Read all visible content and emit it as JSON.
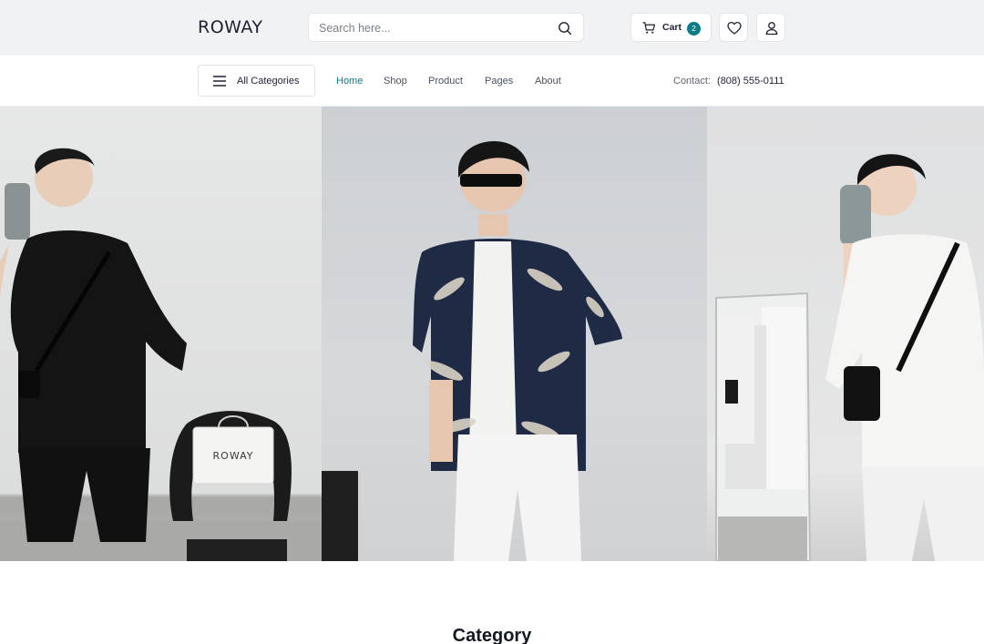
{
  "brand": {
    "logo": "ROWAY"
  },
  "search": {
    "placeholder": "Search here..."
  },
  "header": {
    "cart_label": "Cart",
    "cart_count": "2"
  },
  "nav": {
    "categories_label": "All Categories",
    "links": [
      {
        "label": "Home",
        "active": true
      },
      {
        "label": "Shop",
        "active": false
      },
      {
        "label": "Product",
        "active": false
      },
      {
        "label": "Pages",
        "active": false
      },
      {
        "label": "About",
        "active": false
      }
    ],
    "contact_label": "Contact:",
    "contact_phone": "(808) 555-0111"
  },
  "hero": {
    "bag_brand": "ROWAY"
  },
  "sections": {
    "category_title": "Category"
  },
  "colors": {
    "accent": "#0b7b86",
    "topbar_bg": "#f1f2f4",
    "text_dark": "#1c2133"
  },
  "icons": [
    "search-icon",
    "cart-icon",
    "heart-icon",
    "user-icon",
    "menu-icon"
  ]
}
